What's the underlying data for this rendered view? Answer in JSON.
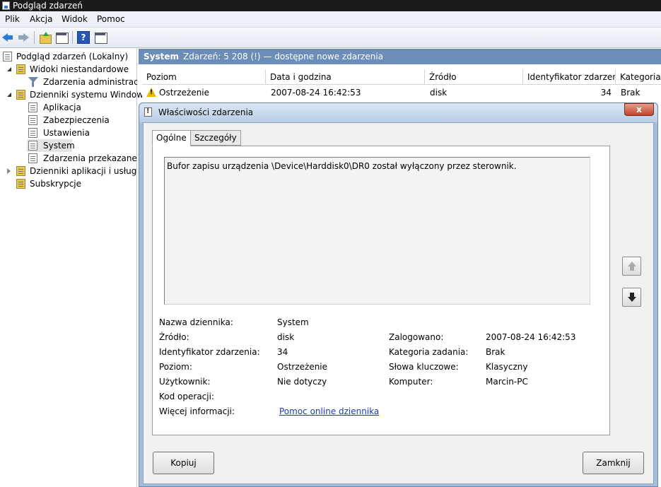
{
  "window": {
    "title": "Podgląd zdarzeń"
  },
  "menu": [
    "Plik",
    "Akcja",
    "Widok",
    "Pomoc"
  ],
  "toolbar": {
    "help_label": "?"
  },
  "tree": {
    "root": "Podgląd zdarzeń (Lokalny)",
    "custom_views": "Widoki niestandardowe",
    "admin_events": "Zdarzenia administracyjne",
    "windows_logs": "Dzienniki systemu Windows",
    "application": "Aplikacja",
    "security": "Zabezpieczenia",
    "setup": "Ustawienia",
    "system": "System",
    "forwarded": "Zdarzenia przekazane",
    "app_services": "Dzienniki aplikacji i usług",
    "subscriptions": "Subskrypcje"
  },
  "log_header": {
    "title": "System",
    "info": "Zdarzeń: 5 208 (!) — dostępne nowe zdarzenia"
  },
  "table": {
    "columns": [
      "Poziom",
      "Data i godzina",
      "Źródło",
      "Identyfikator zdarzenia",
      "Kategoria zadania"
    ],
    "rows": [
      {
        "level": "Ostrzeżenie",
        "date": "2007-08-24 16:42:53",
        "source": "disk",
        "id": "34",
        "category": "Brak"
      }
    ]
  },
  "dialog": {
    "title": "Właściwości zdarzenia",
    "close_label": "x",
    "tabs": [
      "Ogólne",
      "Szczegóły"
    ],
    "description": "Bufor zapisu urządzenia \\Device\\Harddisk0\\DR0 został wyłączony przez sterownik.",
    "fields": {
      "log_name_label": "Nazwa dziennika:",
      "log_name": "System",
      "source_label": "Źródło:",
      "source": "disk",
      "logged_label": "Zalogowano:",
      "logged": "2007-08-24 16:42:53",
      "event_id_label": "Identyfikator zdarzenia:",
      "event_id": "34",
      "task_category_label": "Kategoria zadania:",
      "task_category": "Brak",
      "level_label": "Poziom:",
      "level": "Ostrzeżenie",
      "keywords_label": "Słowa kluczowe:",
      "keywords": "Klasyczny",
      "user_label": "Użytkownik:",
      "user": "Nie dotyczy",
      "computer_label": "Komputer:",
      "computer": "Marcin-PC",
      "opcode_label": "Kod operacji:",
      "opcode": "",
      "more_info_label": "Więcej informacji:",
      "more_info_link": "Pomoc online dziennika"
    },
    "copy_button": "Kopiuj",
    "close_button": "Zamknij"
  }
}
